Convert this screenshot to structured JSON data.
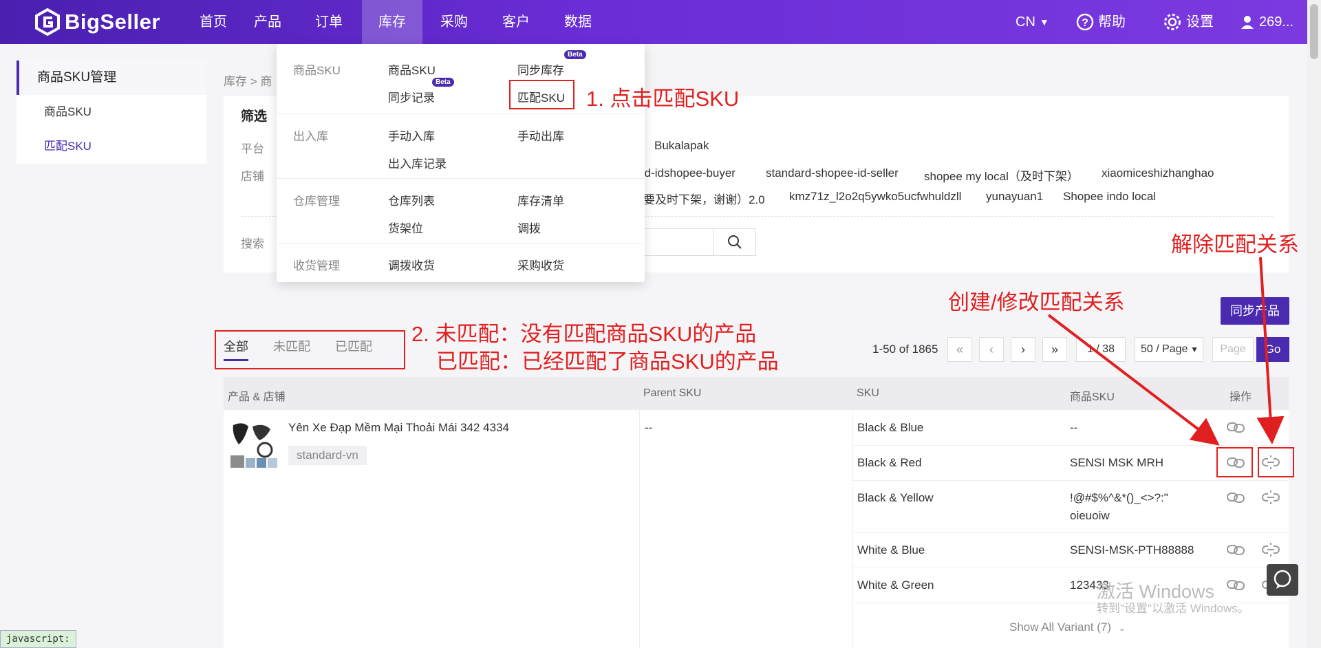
{
  "brand": {
    "name": "BigSeller"
  },
  "nav": {
    "items": [
      "首页",
      "产品",
      "订单",
      "库存",
      "采购",
      "客户",
      "数据"
    ],
    "lang": "CN",
    "help": "帮助",
    "settings": "设置",
    "user": "269..."
  },
  "sidebar": {
    "header": "商品SKU管理",
    "items": [
      "商品SKU",
      "匹配SKU"
    ]
  },
  "breadcrumb": "库存 > 商",
  "filter": {
    "title": "筛选",
    "platform_label": "平台",
    "platform_value": "Bukalapak",
    "store_label": "店铺",
    "stores_row1": [
      "rd-idshopee-buyer",
      "standard-shopee-id-seller",
      "shopee my local（及时下架）",
      "xiaomiceshizhanghao"
    ],
    "stores_row2": [
      "要及时下架，谢谢）2.0",
      "kmz71z_l2o2q5ywko5ucfwhuldzll",
      "yunayuan1",
      "Shopee indo local"
    ],
    "search_label": "搜索"
  },
  "menu": {
    "sections": [
      {
        "category": "商品SKU",
        "items": [
          "商品SKU",
          "同步库存",
          "同步记录",
          "匹配SKU"
        ]
      },
      {
        "category": "出入库",
        "items": [
          "手动入库",
          "手动出库",
          "出入库记录"
        ]
      },
      {
        "category": "仓库管理",
        "items": [
          "仓库列表",
          "库存清单",
          "货架位",
          "调拨"
        ]
      },
      {
        "category": "收货管理",
        "items": [
          "调拨收货",
          "采购收货"
        ]
      }
    ],
    "beta": "Beta"
  },
  "tabs": [
    "全部",
    "未匹配",
    "已匹配"
  ],
  "sync_button": "同步产品",
  "pagination": {
    "summary": "1-50 of 1865",
    "first": "«",
    "prev": "‹",
    "next": "›",
    "last": "»",
    "current": "1 / 38",
    "per_page": "50 / Page",
    "page_placeholder": "Page",
    "go": "Go"
  },
  "table": {
    "headers": [
      "产品 & 店铺",
      "Parent SKU",
      "SKU",
      "商品SKU",
      "操作"
    ],
    "product": {
      "name": "Yên Xe Đạp Mềm Mại Thoải Mái 342 4334",
      "store": "standard-vn",
      "parent_sku": "--"
    },
    "variants": [
      {
        "sku": "Black & Blue",
        "goods_sku": "--"
      },
      {
        "sku": "Black & Red",
        "goods_sku": "SENSI MSK MRH"
      },
      {
        "sku": "Black & Yellow",
        "goods_sku": "!@#$%^&*()_<>?:\"",
        "goods_sku2": "oieuoiw"
      },
      {
        "sku": "White & Blue",
        "goods_sku": "SENSI-MSK-PTH88888"
      },
      {
        "sku": "White & Green",
        "goods_sku": "123433"
      }
    ],
    "show_all": "Show All Variant (7)"
  },
  "annotations": {
    "step1": "1. 点击匹配SKU",
    "step2_line1": "2. 未匹配：没有匹配商品SKU的产品",
    "step2_line2": "已匹配：已经匹配了商品SKU的产品",
    "create": "创建/修改匹配关系",
    "remove": "解除匹配关系"
  },
  "status": "javascript:",
  "watermark": {
    "line1": "激活 Windows",
    "line2": "转到\"设置\"以激活 Windows。"
  },
  "colors": {
    "brand": "#4a2bb0",
    "annotation": "#e02020"
  }
}
